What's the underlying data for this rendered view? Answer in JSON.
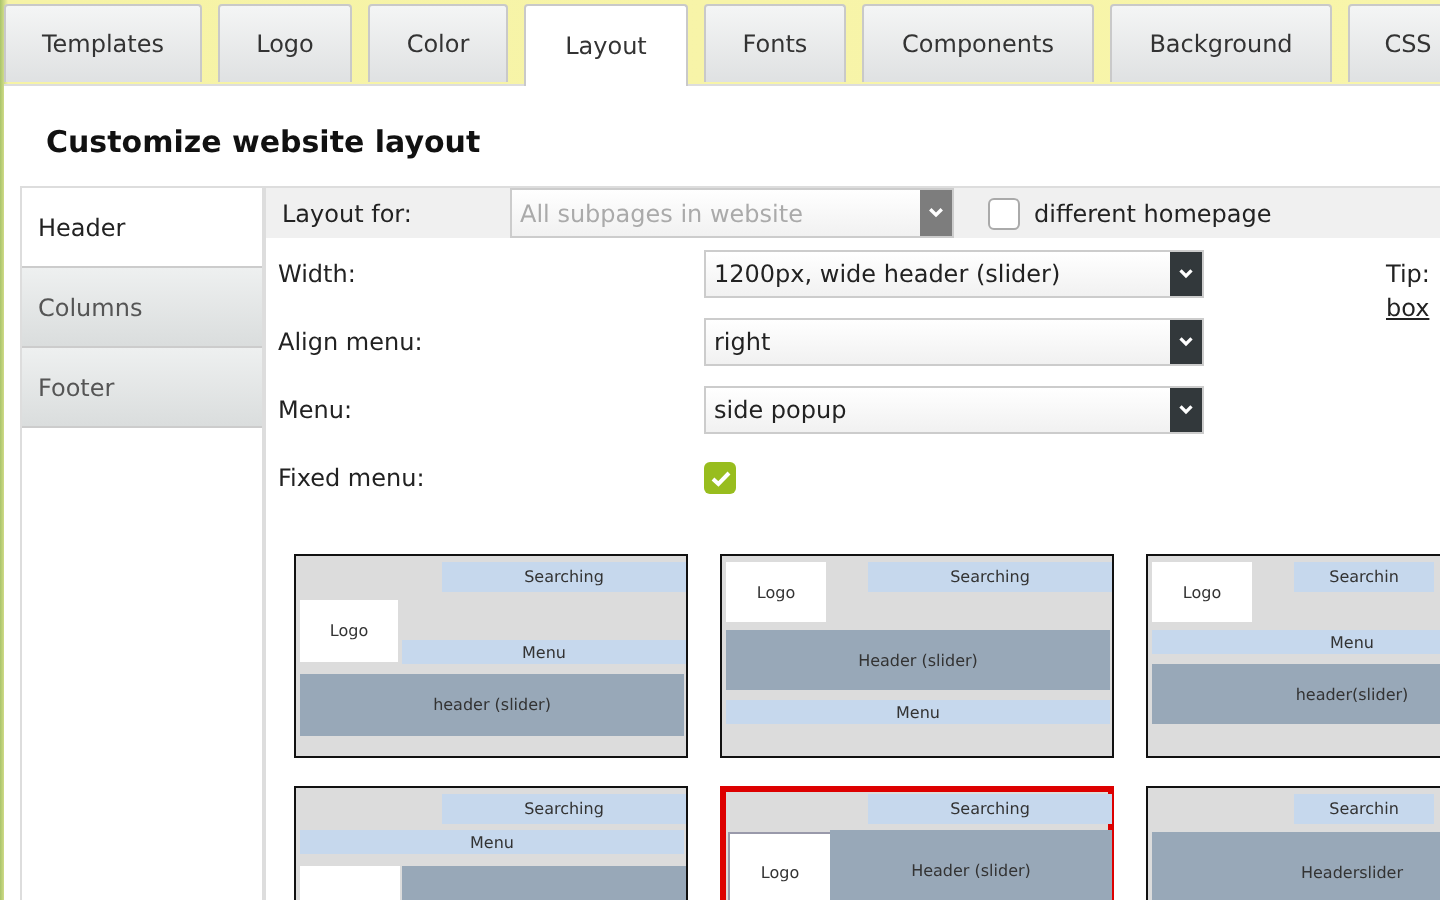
{
  "tabs": [
    {
      "label": "Templates",
      "selected": false
    },
    {
      "label": "Logo",
      "selected": false
    },
    {
      "label": "Color",
      "selected": false
    },
    {
      "label": "Layout",
      "selected": true
    },
    {
      "label": "Fonts",
      "selected": false
    },
    {
      "label": "Components",
      "selected": false
    },
    {
      "label": "Background",
      "selected": false
    },
    {
      "label": "CSS",
      "selected": false
    }
  ],
  "page_title": "Customize website layout",
  "sidebar": {
    "items": [
      {
        "label": "Header",
        "selected": true
      },
      {
        "label": "Columns",
        "selected": false
      },
      {
        "label": "Footer",
        "selected": false
      }
    ]
  },
  "layout_for": {
    "label": "Layout for:",
    "value": "All subpages in website",
    "disabled": true
  },
  "different_homepage": {
    "label": "different homepage",
    "checked": false
  },
  "fields": [
    {
      "kind": "select",
      "label": "Width:",
      "value": "1200px, wide header (slider)"
    },
    {
      "kind": "select",
      "label": "Align menu:",
      "value": "right"
    },
    {
      "kind": "select",
      "label": "Menu:",
      "value": "side popup"
    },
    {
      "kind": "checkbox",
      "label": "Fixed menu:",
      "checked": true
    }
  ],
  "tip": {
    "text": "Tip:",
    "link": "box"
  },
  "thumbnails": [
    {
      "selected": false,
      "search": "Searching",
      "logo": "Logo",
      "menu": "Menu",
      "header": "header (slider)"
    },
    {
      "selected": false,
      "search": "Searching",
      "logo": "Logo",
      "menu": "Menu",
      "header": "Header (slider)"
    },
    {
      "selected": false,
      "search": "Searchin",
      "logo": "Logo",
      "menu": "Menu",
      "header": "header(slider)"
    },
    {
      "selected": false,
      "search": "Searching",
      "menu": "Menu"
    },
    {
      "selected": true,
      "search": "Searching",
      "logo": "Logo",
      "header": "Header (slider)"
    },
    {
      "selected": false,
      "search": "Searchin",
      "header": "Headerslider"
    }
  ]
}
